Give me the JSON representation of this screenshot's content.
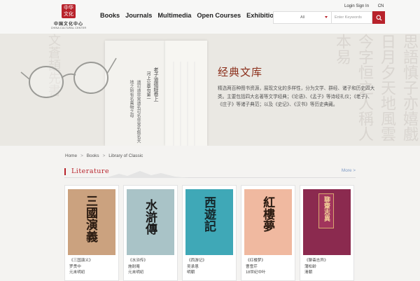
{
  "header": {
    "logo_seal": "中华文化",
    "logo_cn": "中国文化中心",
    "logo_en": "CHINA CULTURAL CENTER",
    "nav": [
      "Books",
      "Journals",
      "Multimedia",
      "Open Courses",
      "Exhibitions"
    ],
    "login": "Login Sign In",
    "lang": "CN",
    "search_scope": "All",
    "search_placeholder": "Enter Keywords"
  },
  "banner": {
    "title": "经典文库",
    "description": "精选两百种图书资源，展现文化的多样性，分为文学、群经、诸子和历史四大类。主要包括四大名著等文学经典；《论语》、《孟子》等诗经礼仪；《老子》、《庄子》等诸子典范；以及《史记》、《汉书》等历史典藏。",
    "bg_text": "思語慎子亦嬉戲日月夕天地風雲今字恒之人稱人本易",
    "left_bg_text": "文蒼頡先書",
    "book_text_1": "老子道德經卷上",
    "book_text_2": "河上公章句第一",
    "book_text_3": "道可道非常道名可名非常名無名天地之始有名萬物之母"
  },
  "breadcrumb": [
    "Home",
    "Books",
    "Library of Classic"
  ],
  "section": {
    "title": "Literature",
    "more": "More >"
  },
  "books": [
    {
      "cover_title": "三國演義",
      "title": "《三国演义》",
      "author": "罗贯中",
      "era": "元末明初",
      "bg": "#cba27f",
      "accent": "#8a1f18"
    },
    {
      "cover_title": "水滸傳",
      "title": "《水浒传》",
      "author": "施耐庵",
      "era": "元末明初",
      "bg": "#a9c3c7",
      "accent": "#8a1f18"
    },
    {
      "cover_title": "西遊記",
      "title": "《西游记》",
      "author": "吴承恩",
      "era": "明朝",
      "bg": "#3fa8b7",
      "accent": "#8a1f18"
    },
    {
      "cover_title": "紅樓夢",
      "title": "《红楼梦》",
      "author": "曹雪芹",
      "era": "18世纪中叶",
      "bg": "#f0b9a0",
      "accent": "#8a1f18"
    },
    {
      "cover_title": "聊齋志異",
      "title": "《聊斋志异》",
      "author": "蒲松龄",
      "era": "清朝",
      "bg": "#8b2a4f",
      "accent": "#f5d59a"
    }
  ]
}
